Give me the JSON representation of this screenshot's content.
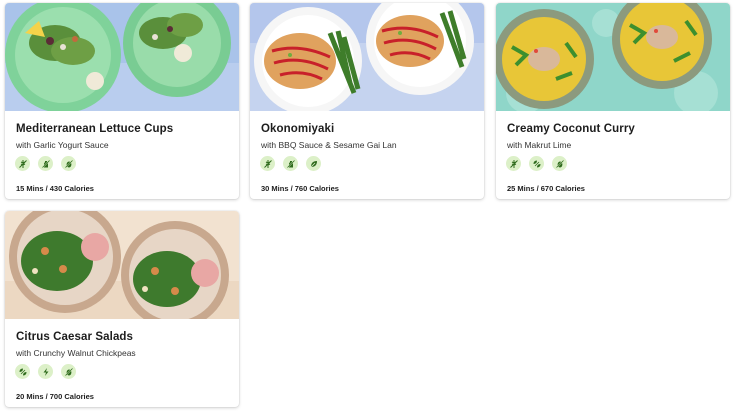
{
  "recipes": [
    {
      "title": "Mediterranean Lettuce Cups",
      "subtitle": "with Garlic Yogurt Sauce",
      "meta": "15 Mins / 430 Calories",
      "tags": [
        "no-gluten-icon",
        "no-dairy-icon",
        "no-nuts-icon"
      ]
    },
    {
      "title": "Okonomiyaki",
      "subtitle": "with BBQ Sauce & Sesame Gai Lan",
      "meta": "30 Mins / 760 Calories",
      "tags": [
        "no-gluten-icon",
        "no-dairy-icon",
        "vegetarian-icon"
      ]
    },
    {
      "title": "Creamy Coconut Curry",
      "subtitle": "with Makrut Lime",
      "meta": "25 Mins / 670 Calories",
      "tags": [
        "no-gluten-icon",
        "vegan-icon",
        "no-nuts-icon"
      ]
    },
    {
      "title": "Citrus Caesar Salads",
      "subtitle": "with Crunchy Walnut Chickpeas",
      "meta": "20 Mins / 700 Calories",
      "tags": [
        "vegan-icon",
        "quick-prep-icon",
        "no-nuts-icon"
      ]
    }
  ],
  "colors": {
    "tag_bg": "#dcf0c8",
    "tag_icon": "#2f6b1d",
    "card_shadow": "#d8d8d8"
  }
}
